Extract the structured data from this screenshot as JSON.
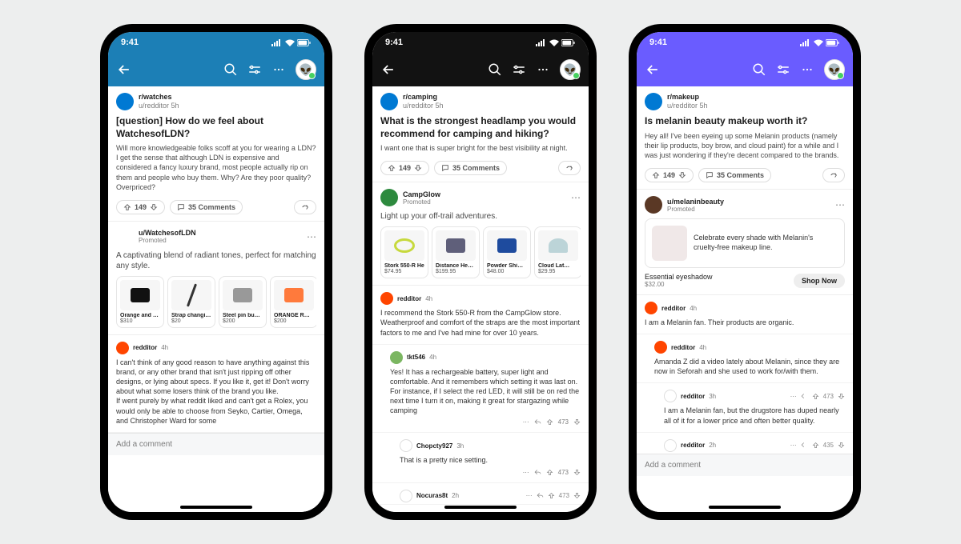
{
  "status": {
    "time": "9:41"
  },
  "phones": [
    {
      "theme": {
        "header_bg": "#1c7fb6"
      },
      "post": {
        "subreddit": "r/watches",
        "user": "u/redditor",
        "age": "5h",
        "title": "[question] How do we feel about WatchesofLDN?",
        "body": "Will more knowledgeable folks scoff at you for wearing a LDN? I get the sense that although LDN is expensive and considered a fancy luxury brand, most people actually rip on them and people who buy them. Why? Are they poor quality? Overpriced?",
        "upvotes": "149",
        "comments_label": "35 Comments"
      },
      "promo": {
        "advertiser": "u/WatchesofLDN",
        "label": "Promoted",
        "avatar_bg": "#6b3a1f",
        "text": "A captivating blend of radiant tones, perfect for matching any style.",
        "products": [
          {
            "name": "Orange and B…",
            "price": "$310",
            "color": "#111"
          },
          {
            "name": "Strap changi…",
            "price": "$20",
            "color": "#333"
          },
          {
            "name": "Steel pin buc…",
            "price": "$200",
            "color": "#999"
          },
          {
            "name": "ORANGE R…",
            "price": "$200",
            "color": "#ff7a3c"
          }
        ]
      },
      "comments": [
        {
          "user": "redditor",
          "age": "4h",
          "body": "I can't think of any good reason to have anything against this brand, or any other brand that isn't just ripping off other designs, or lying about specs. If you like it, get it! Don't worry about what some losers think of the brand you like.\nIf went purely by what reddit liked and can't get a Rolex, you would only be able to choose from Seyko, Cartier, Omega, and Christopher Ward for some"
        }
      ],
      "add_comment": "Add a comment"
    },
    {
      "theme": {
        "header_bg": "#121212"
      },
      "post": {
        "subreddit": "r/camping",
        "user": "u/redditor",
        "age": "5h",
        "title": "What is the strongest headlamp you would recommend for camping and hiking?",
        "body": "I want one that is super bright for the best visibility at night.",
        "upvotes": "149",
        "comments_label": "35 Comments"
      },
      "promo": {
        "advertiser": "CampGlow",
        "label": "Promoted",
        "avatar_bg": "#2d8a3e",
        "text": "Light up your off-trail adventures.",
        "products": [
          {
            "name": "Stork 550-R He",
            "price": "$74.95",
            "color": "#c7d93d"
          },
          {
            "name": "Distance Hea…",
            "price": "$199.95",
            "color": "#5f5f7a"
          },
          {
            "name": "Powder Shim…",
            "price": "$48.00",
            "color": "#1e4b9e"
          },
          {
            "name": "Cloud Lat…",
            "price": "$29.95",
            "color": "#bcd4d8"
          }
        ]
      },
      "comments": [
        {
          "user": "redditor",
          "age": "4h",
          "body": "I recommend the Stork 550-R from the CampGlow store. Weatherproof and comfort of the straps are the most important factors to me and I've had mine for over 10 years."
        },
        {
          "user": "tkt546",
          "age": "4h",
          "nested": true,
          "body": "Yes! It has a rechargeable battery, super light and comfortable. And it remembers which setting it was last on. For instance, if I select the red LED, it will still be on red the next time I turn it on, making it great for stargazing while camping",
          "votes": "473"
        },
        {
          "user": "Chopcty927",
          "age": "3h",
          "nested2": true,
          "body": "That is a pretty nice setting.",
          "votes": "473"
        },
        {
          "user": "Nocuras8t",
          "age": "2h",
          "nested2": true,
          "body": "",
          "votes": "473"
        }
      ]
    },
    {
      "theme": {
        "header_bg": "#6a5cff"
      },
      "post": {
        "subreddit": "r/makeup",
        "user": "u/redditor",
        "age": "5h",
        "title": "Is melanin beauty makeup worth it?",
        "body": "Hey all! I've been eyeing up some Melanin products (namely their lip products, boy brow, and cloud paint) for a while and I was just wondering if they're decent compared to the brands.",
        "upvotes": "149",
        "comments_label": "35 Comments"
      },
      "promo_card": {
        "advertiser": "u/melaninbeauty",
        "label": "Promoted",
        "avatar_bg": "#5a3825",
        "text": "Celebrate every shade with Melanin's cruelty-free makeup line.",
        "product_name": "Essential eyeshadow",
        "product_price": "$32.00",
        "cta": "Shop Now"
      },
      "comments": [
        {
          "user": "redditor",
          "age": "4h",
          "body": "I am a Melanin fan. Their products are organic."
        },
        {
          "user": "redditor",
          "age": "4h",
          "nested": true,
          "body": "Amanda Z did a video lately about Melanin, since they are now in Seforah and she used to work for/with them."
        },
        {
          "user": "redditor",
          "age": "3h",
          "nested2": true,
          "body": "I am a Melanin fan, but the drugstore has duped nearly all of it for a lower price and often better quality.",
          "votes": "473"
        },
        {
          "user": "redditor",
          "age": "2h",
          "nested2": true,
          "body": "",
          "votes": "435"
        }
      ],
      "add_comment": "Add a comment"
    }
  ]
}
